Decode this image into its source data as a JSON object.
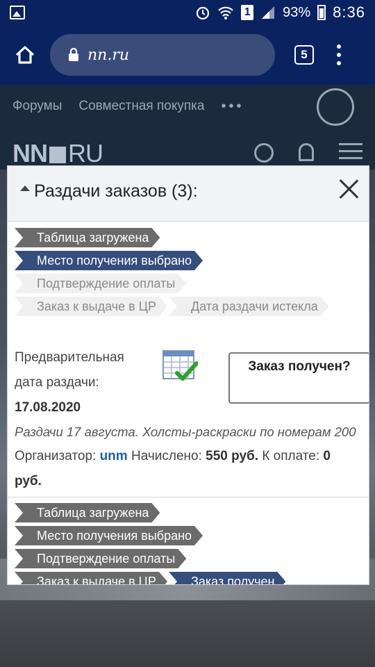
{
  "status_bar": {
    "battery": "93%",
    "time": "8:36",
    "sim": "1"
  },
  "browser": {
    "url": "nn.ru",
    "tab_count": "5"
  },
  "site": {
    "nav": [
      "Форумы",
      "Совместная покупка",
      "•••"
    ],
    "logo_left": "NN",
    "logo_right": "RU"
  },
  "modal": {
    "title": "Раздачи заказов (3):",
    "orders": [
      {
        "steps_row1": [
          {
            "label": "Таблица загружена",
            "state": "gray"
          }
        ],
        "steps_row2": [
          {
            "label": "Место получения выбрано",
            "state": "blue"
          }
        ],
        "steps_row3": [
          {
            "label": "Подтверждение оплаты",
            "state": "light"
          }
        ],
        "steps_row4": [
          {
            "label": "Заказ к выдаче в ЦР",
            "state": "light"
          },
          {
            "label": "Дата раздачи истекла",
            "state": "light"
          }
        ],
        "date_label": "Предварительная дата раздачи:",
        "date_value": "17.08.2020",
        "button_label": "Заказ получен?",
        "description": "Раздачи 17 августа. Холсты-раскраски по номерам 200",
        "organizer_label": "Организатор:",
        "organizer": "unm",
        "accrued_label": "Начислено:",
        "accrued": "550 руб.",
        "to_pay_label": "К оплате:",
        "to_pay": "0 руб."
      },
      {
        "steps_row1": [
          {
            "label": "Таблица загружена",
            "state": "gray"
          }
        ],
        "steps_row2": [
          {
            "label": "Место получения выбрано",
            "state": "gray"
          }
        ],
        "steps_row3": [
          {
            "label": "Подтверждение оплаты",
            "state": "gray"
          }
        ],
        "steps_row4": [
          {
            "label": "Заказ к выдаче в ЦР",
            "state": "gray"
          },
          {
            "label": "Заказ получен",
            "state": "blue"
          }
        ]
      }
    ]
  },
  "colors": {
    "step_gray": "#6b6b6b",
    "step_blue": "#354e7c",
    "step_light": "#f0f0f0",
    "link": "#1f5ea8",
    "toolbar": "#0b2260"
  }
}
